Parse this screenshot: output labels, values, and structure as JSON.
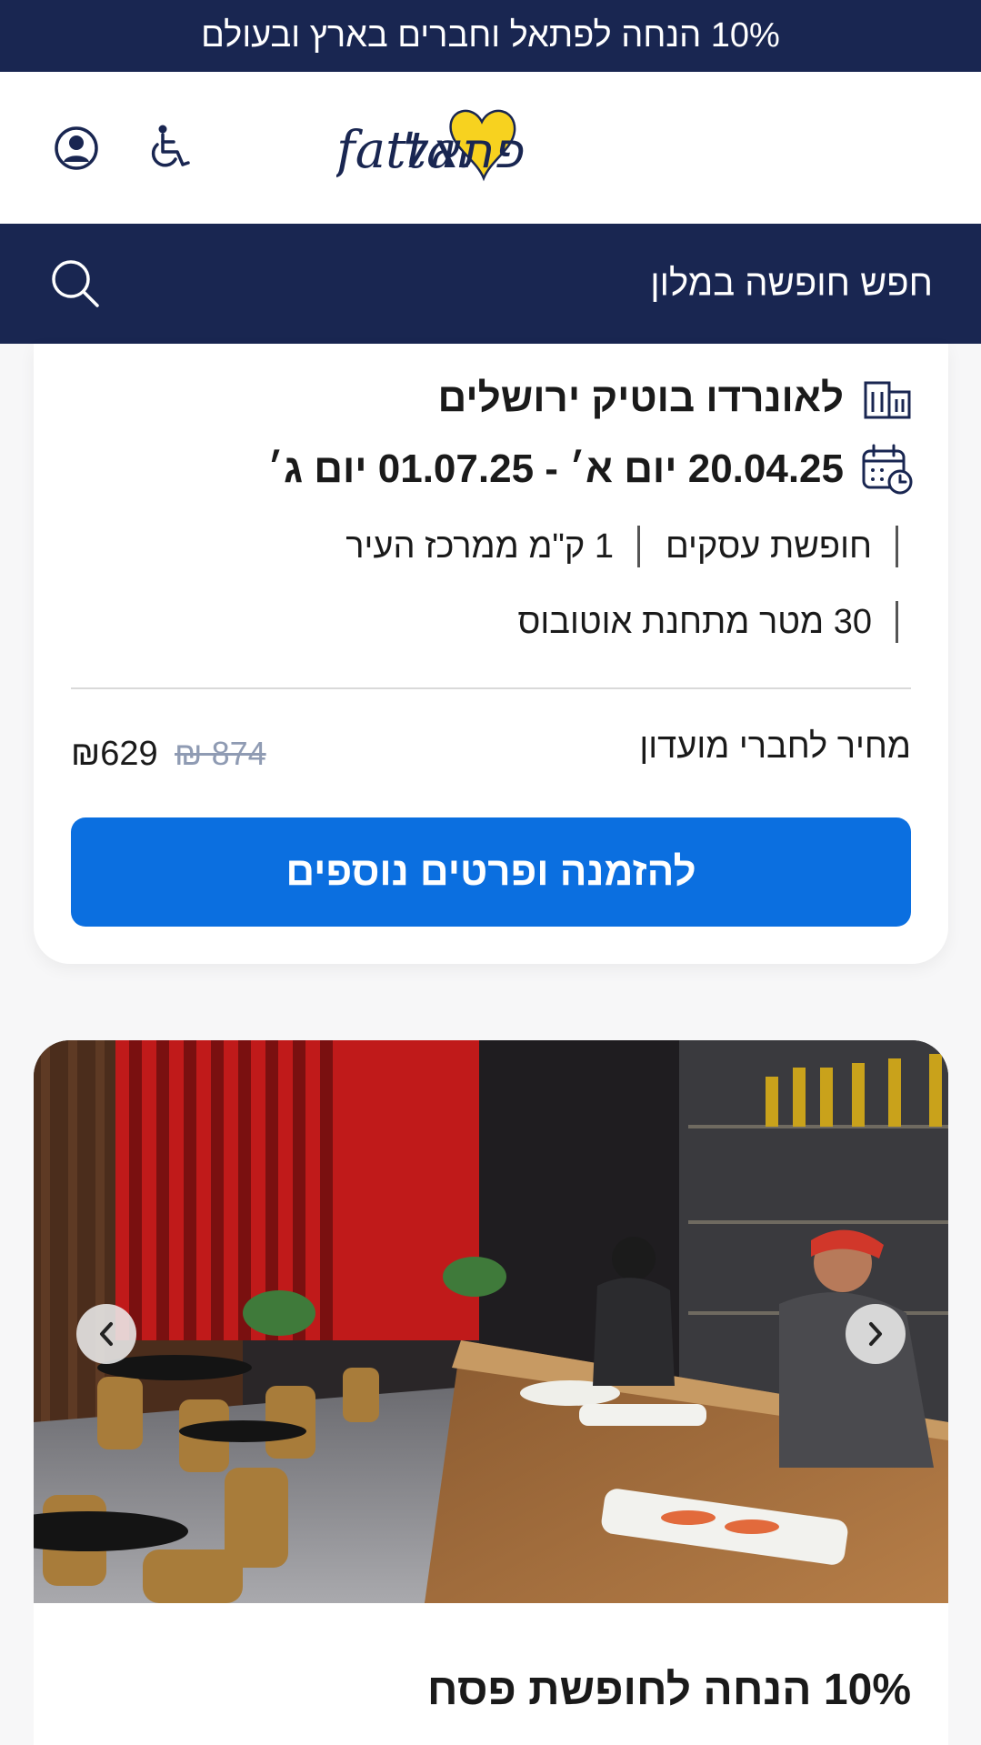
{
  "banner": {
    "text": "10% הנחה לפתאל וחברים בארץ ובעולם"
  },
  "header": {
    "logo_hebrew": "פתאל",
    "logo_latin": "fattal",
    "user_icon": "user-circle-icon",
    "accessibility_icon": "wheelchair-icon"
  },
  "search": {
    "label": "חפש חופשה במלון",
    "icon": "search-icon"
  },
  "deal": {
    "hotel_name": "לאונרדו בוטיק ירושלים",
    "dates": "20.04.25 יום א׳ - 01.07.25 יום ג׳",
    "tags_row1": [
      "חופשת עסקים",
      "1 ק\"מ ממרכז העיר"
    ],
    "tags_row2": [
      "30 מטר מתחנת אוטובוס"
    ],
    "price_label": "מחיר לחברי מועדון",
    "price_now": "₪629",
    "price_old": "₪ 874",
    "cta": "להזמנה ופרטים נוספים"
  },
  "deal2": {
    "title": "10% הנחה לחופשת פסח"
  },
  "colors": {
    "navy": "#192651",
    "cta_blue": "#0b6fe0",
    "logo_yellow": "#f7d21f",
    "old_price": "#8f9bb3"
  }
}
